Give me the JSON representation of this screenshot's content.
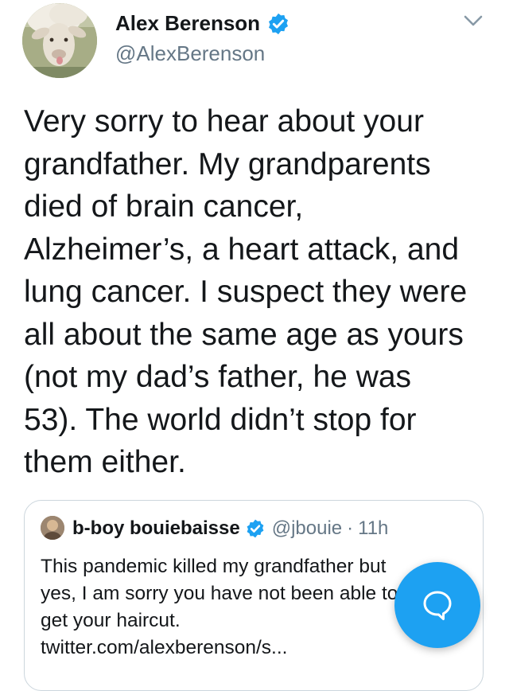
{
  "tweet": {
    "author": {
      "name": "Alex Berenson",
      "handle": "@AlexBerenson",
      "verified": true,
      "avatar_icon": "sheep-avatar"
    },
    "text": "Very sorry to hear about your\ngrandfather. My grandparents\ndied of brain cancer,\nAlzheimer’s, a heart attack, and\nlung cancer. I suspect they were\nall about the same age as yours\n(not my dad’s father, he was\n53). The world didn’t stop for\nthem either."
  },
  "quoted_tweet": {
    "name": "b-boy bouiebaisse",
    "handle": "@jbouie",
    "separator": "·",
    "time": "11h",
    "verified": true,
    "text": "This pandemic killed my grandfather but\nyes, I am sorry you have not been able to\nget your haircut.\ntwitter.com/alexberenson/s..."
  },
  "actions": {
    "compose_icon": "reply-bubble-icon",
    "menu_icon": "chevron-down-icon"
  },
  "colors": {
    "accent": "#1da1f2",
    "text": "#14171a",
    "secondary_text": "#657786",
    "border": "#ccd6dd"
  }
}
